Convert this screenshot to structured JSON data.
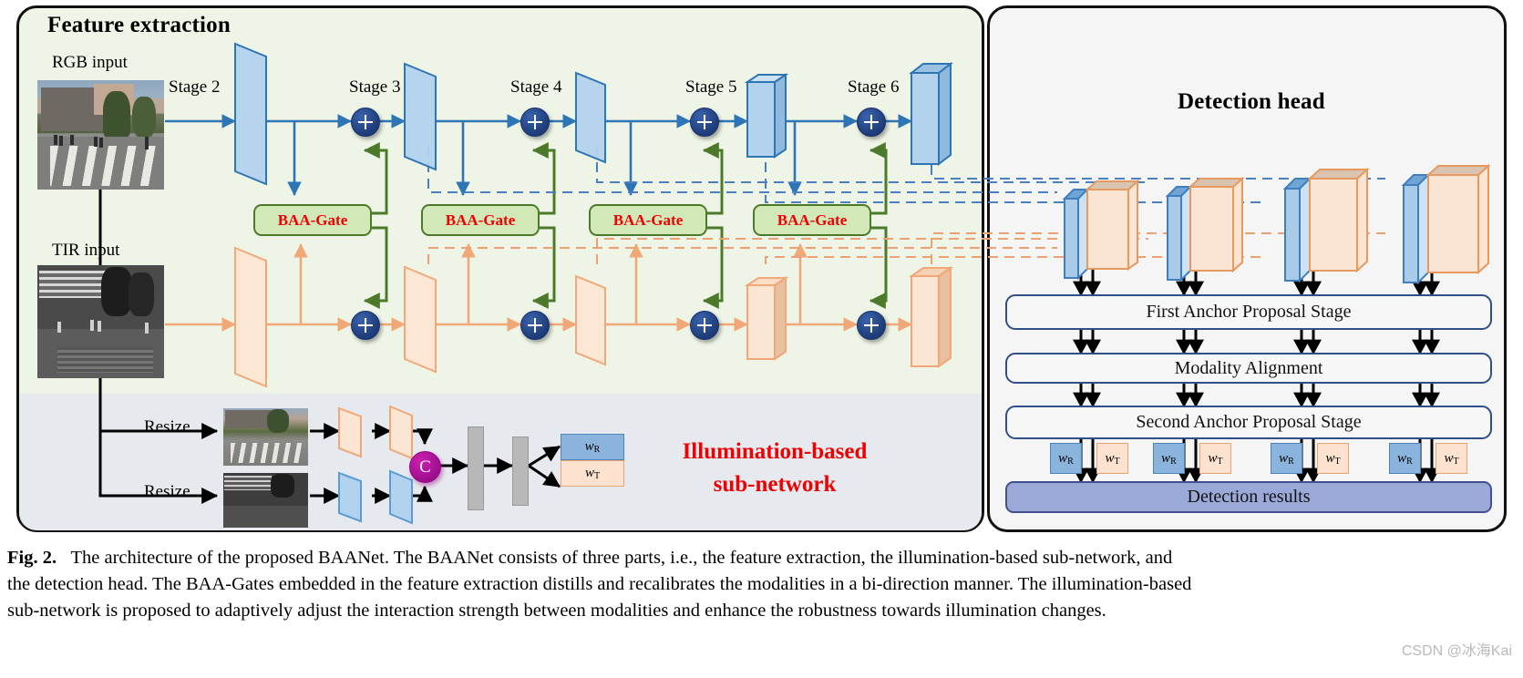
{
  "figure": {
    "number": "Fig. 2.",
    "caption_line1": "The architecture of the proposed BAANet. The BAANet consists of three parts, i.e., the feature extraction, the illumination-based sub-network, and",
    "caption_line2": "the detection head. The BAA-Gates embedded in the feature extraction distills and recalibrates the modalities in a bi-direction manner. The illumination-based",
    "caption_line3": "sub-network is proposed to adaptively adjust the interaction strength between modalities and enhance the robustness towards illumination changes.",
    "watermark": "CSDN @冰海Kai"
  },
  "feature_extraction": {
    "title": "Feature extraction",
    "rgb_input_label": "RGB input",
    "tir_input_label": "TIR input",
    "stages": [
      {
        "label": "Stage 2"
      },
      {
        "label": "Stage 3"
      },
      {
        "label": "Stage 4"
      },
      {
        "label": "Stage 5"
      },
      {
        "label": "Stage 6"
      }
    ],
    "gates": [
      {
        "label": "BAA-Gate"
      },
      {
        "label": "BAA-Gate"
      },
      {
        "label": "BAA-Gate"
      },
      {
        "label": "BAA-Gate"
      }
    ],
    "fusion_symbol": "+",
    "colors": {
      "rgb_stream": "#2e75b6",
      "tir_stream": "#f0a878",
      "gate_border": "#4c7a2a",
      "gate_fill": "#d3e8b9",
      "gate_text": "#f00000",
      "panel_bg": "#eef5e6"
    }
  },
  "illumination_subnetwork": {
    "title_line1": "Illumination-based",
    "title_line2": "sub-network",
    "resize_label_rgb": "Resize",
    "resize_label_tir": "Resize",
    "concat_symbol": "C",
    "weights": [
      {
        "label": "w",
        "sub": "R"
      },
      {
        "label": "w",
        "sub": "T"
      }
    ],
    "colors": {
      "panel_bg": "#e6e9ee",
      "concat": "#b5108f",
      "title_text": "#f00000",
      "w_r_fill": "#8ab4dc",
      "w_t_fill": "#fde3cf"
    }
  },
  "detection_head": {
    "title": "Detection head",
    "stages": [
      {
        "label": "First Anchor Proposal Stage"
      },
      {
        "label": "Modality Alignment"
      },
      {
        "label": "Second Anchor Proposal Stage"
      }
    ],
    "results_label": "Detection results",
    "weight_pairs": [
      {
        "r": "w",
        "r_sub": "R",
        "t": "w",
        "t_sub": "T"
      },
      {
        "r": "w",
        "r_sub": "R",
        "t": "w",
        "t_sub": "T"
      },
      {
        "r": "w",
        "r_sub": "R",
        "t": "w",
        "t_sub": "T"
      },
      {
        "r": "w",
        "r_sub": "R",
        "t": "w",
        "t_sub": "T"
      }
    ],
    "colors": {
      "panel_bg": "#f5f5f5",
      "box_border": "#2f4f86",
      "results_fill": "#9aa9d8"
    }
  }
}
